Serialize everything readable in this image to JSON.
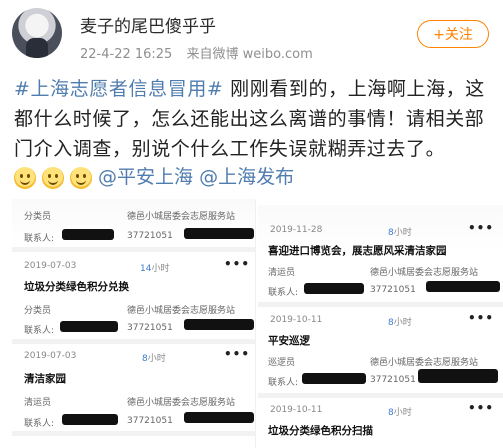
{
  "post": {
    "username": "麦子的尾巴傻乎乎",
    "timestamp": "22-4-22 16:25",
    "source": "来自微博 weibo.com",
    "follow_label": "+关注",
    "topic": "#上海志愿者信息冒用#",
    "body": " 刚刚看到的，上海啊上海，这都什么时候了，怎么还能出这么离谱的事情！请相关部门介入调查，别说个什么工作失误就糊弄过去了。",
    "emoji_count": 3,
    "mention_1": "@平安上海",
    "mention_2": "@上海发布"
  },
  "left_shot": {
    "row1_role": "分类员",
    "row1_org": "德邑小城居委会志愿服务站",
    "row1_contact_label": "联系人:",
    "row1_phone": "37721051",
    "row2_date": "2019-07-03",
    "row2_hours": "14",
    "row2_hours_unit": "小时",
    "row2_dots": "•••",
    "row2_title": "垃圾分类绿色积分兑换",
    "row2_role": "分类员",
    "row2_org": "德邑小城居委会志愿服务站",
    "row2_contact_label": "联系人:",
    "row2_phone": "37721051",
    "row3_date": "2019-07-03",
    "row3_hours": "8",
    "row3_hours_unit": "小时",
    "row3_dots": "•••",
    "row3_title": "清洁家园",
    "row3_role": "清运员",
    "row3_org": "德邑小城居委会志愿服务站",
    "row3_contact_label": "联系人:",
    "row3_phone": "37721051"
  },
  "right_shot": {
    "row1_date": "2019-11-28",
    "row1_hours": "8",
    "row1_hours_unit": "小时",
    "row1_dots": "•••",
    "row1_title": "喜迎进口博览会，展志愿风采清洁家园",
    "row1_role": "清运员",
    "row1_org": "德邑小城居委会志愿服务站",
    "row1_contact_label": "联系人:",
    "row1_phone": "37721051",
    "row2_date": "2019-10-11",
    "row2_hours": "8",
    "row2_hours_unit": "小时",
    "row2_dots": "•••",
    "row2_title": "平安巡逻",
    "row2_role": "巡逻员",
    "row2_org": "德邑小城居委会志愿服务站",
    "row2_contact_label": "联系人:",
    "row2_phone": "37721051",
    "row3_date": "2019-10-11",
    "row3_hours": "8",
    "row3_hours_unit": "小时",
    "row3_dots": "•••",
    "row3_title": "垃圾分类绿色积分扫描"
  }
}
